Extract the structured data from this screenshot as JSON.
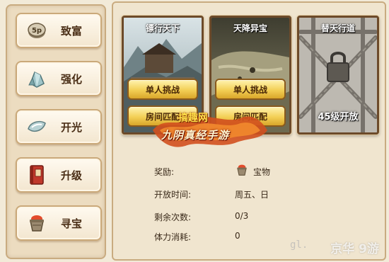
{
  "sidebar": {
    "items": [
      {
        "label": "致富",
        "icon": "coin-icon"
      },
      {
        "label": "强化",
        "icon": "crystal-icon"
      },
      {
        "label": "开光",
        "icon": "jade-icon"
      },
      {
        "label": "升级",
        "icon": "book-icon"
      },
      {
        "label": "寻宝",
        "icon": "treasure-pot-icon"
      }
    ]
  },
  "cards": [
    {
      "title": "镖行天下",
      "solo_label": "单人挑战",
      "room_label": "房间匹配"
    },
    {
      "title": "天降异宝",
      "solo_label": "单人挑战",
      "room_label": "房间匹配"
    },
    {
      "title": "替天行道",
      "locked_label": "45级开放"
    }
  ],
  "banner": {
    "site": "搞趣网",
    "game": "九阴真经手游"
  },
  "info": {
    "reward_label": "奖励:",
    "reward_value": "宝物",
    "open_time_label": "开放时间:",
    "open_time_value": "周五、日",
    "remaining_label": "剩余次数:",
    "remaining_value": "0/3",
    "stamina_label": "体力消耗:",
    "stamina_value": "0"
  },
  "watermark": {
    "left": "gl.",
    "right": "京华 9游"
  },
  "colors": {
    "button_gold": "#f3cf55",
    "frame_brown": "#6c4a2a",
    "panel_bg": "#f0e5cf"
  }
}
